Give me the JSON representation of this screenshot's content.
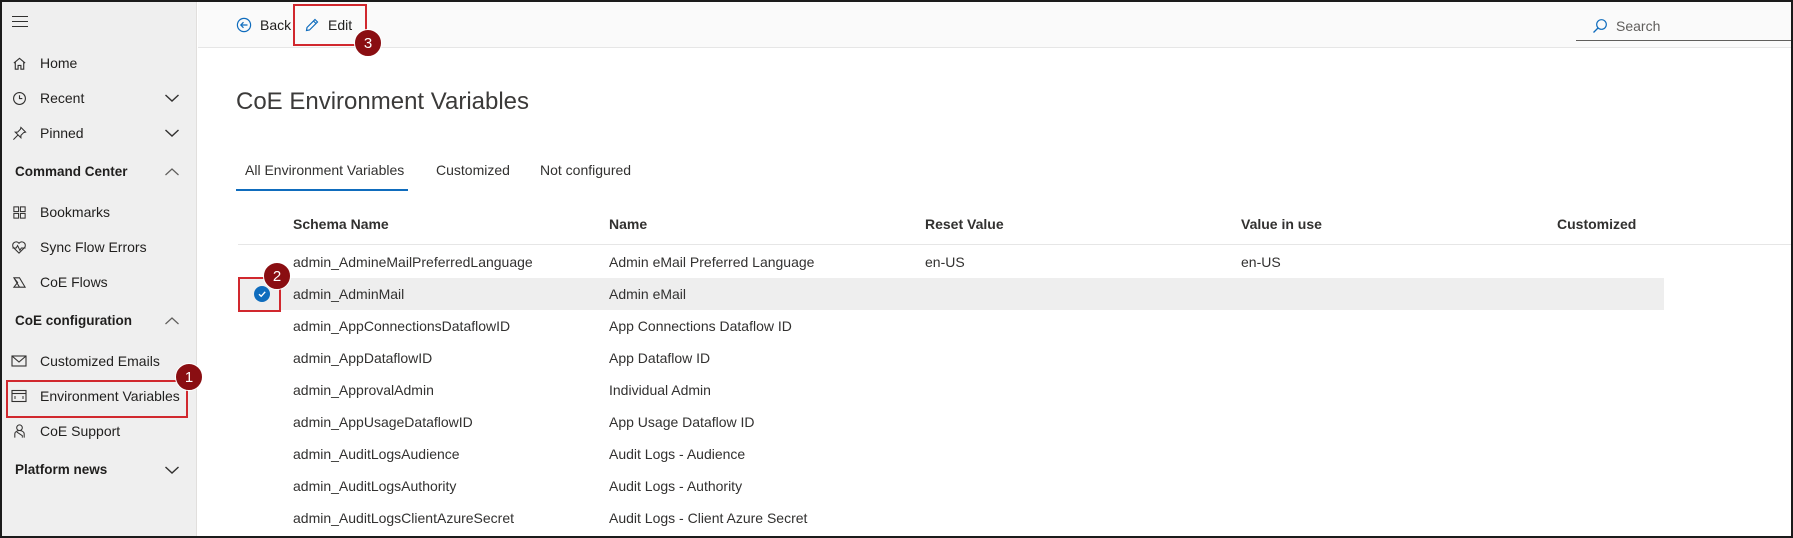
{
  "sidebar": {
    "items": [
      {
        "label": "Home",
        "icon": "home-icon"
      },
      {
        "label": "Recent",
        "icon": "clock-icon"
      },
      {
        "label": "Pinned",
        "icon": "pin-icon"
      }
    ],
    "sections": [
      {
        "title": "Command Center",
        "items": [
          {
            "label": "Bookmarks",
            "icon": "bookmark-icon"
          },
          {
            "label": "Sync Flow Errors",
            "icon": "heartbeat-icon"
          },
          {
            "label": "CoE Flows",
            "icon": "flow-icon"
          }
        ]
      },
      {
        "title": "CoE configuration",
        "items": [
          {
            "label": "Customized Emails",
            "icon": "mail-icon"
          },
          {
            "label": "Environment Variables",
            "icon": "variables-icon"
          },
          {
            "label": "CoE Support",
            "icon": "support-icon"
          }
        ]
      },
      {
        "title": "Platform news",
        "items": []
      }
    ]
  },
  "toolbar": {
    "back_label": "Back",
    "edit_label": "Edit",
    "search_label": "Search"
  },
  "page": {
    "title": "CoE Environment Variables",
    "tabs": [
      {
        "label": "All Environment Variables",
        "active": true
      },
      {
        "label": "Customized",
        "active": false
      },
      {
        "label": "Not configured",
        "active": false
      }
    ]
  },
  "table": {
    "columns": [
      "Schema Name",
      "Name",
      "Reset Value",
      "Value in use",
      "Customized"
    ],
    "rows": [
      {
        "schema": "admin_AdmineMailPreferredLanguage",
        "name": "Admin eMail Preferred Language",
        "reset": "en-US",
        "inuse": "en-US",
        "customized": "",
        "selected": false
      },
      {
        "schema": "admin_AdminMail",
        "name": "Admin eMail",
        "reset": "",
        "inuse": "",
        "customized": "",
        "selected": true
      },
      {
        "schema": "admin_AppConnectionsDataflowID",
        "name": "App Connections Dataflow ID",
        "reset": "",
        "inuse": "",
        "customized": "",
        "selected": false
      },
      {
        "schema": "admin_AppDataflowID",
        "name": "App Dataflow ID",
        "reset": "",
        "inuse": "",
        "customized": "",
        "selected": false
      },
      {
        "schema": "admin_ApprovalAdmin",
        "name": "Individual Admin",
        "reset": "",
        "inuse": "",
        "customized": "",
        "selected": false
      },
      {
        "schema": "admin_AppUsageDataflowID",
        "name": "App Usage Dataflow ID",
        "reset": "",
        "inuse": "",
        "customized": "",
        "selected": false
      },
      {
        "schema": "admin_AuditLogsAudience",
        "name": "Audit Logs - Audience",
        "reset": "",
        "inuse": "",
        "customized": "",
        "selected": false
      },
      {
        "schema": "admin_AuditLogsAuthority",
        "name": "Audit Logs - Authority",
        "reset": "",
        "inuse": "",
        "customized": "",
        "selected": false
      },
      {
        "schema": "admin_AuditLogsClientAzureSecret",
        "name": "Audit Logs - Client Azure Secret",
        "reset": "",
        "inuse": "",
        "customized": "",
        "selected": false
      }
    ]
  },
  "callouts": [
    "1",
    "2",
    "3"
  ],
  "colors": {
    "accent": "#0f6cbd",
    "callout_border": "#d1282e",
    "callout_badge": "#8a0e12",
    "sidebar_bg": "#efefef",
    "selected_row": "#eeeeee"
  }
}
